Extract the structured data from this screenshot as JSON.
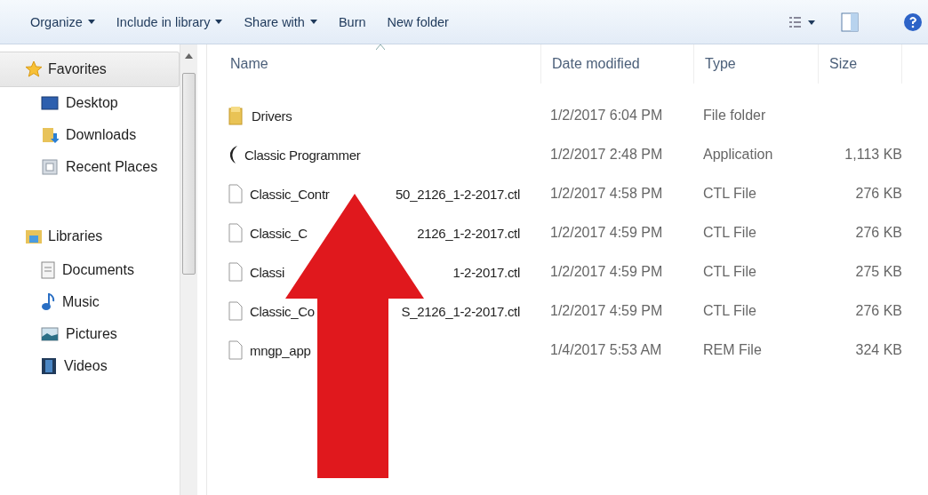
{
  "toolbar": {
    "items": [
      {
        "label": "Organize",
        "dropdown": true
      },
      {
        "label": "Include in library",
        "dropdown": true
      },
      {
        "label": "Share with",
        "dropdown": true
      },
      {
        "label": "Burn",
        "dropdown": false
      },
      {
        "label": "New folder",
        "dropdown": false
      }
    ]
  },
  "sidebar": {
    "groups": [
      {
        "label": "Favorites",
        "selected": true,
        "children": [
          {
            "label": "Desktop"
          },
          {
            "label": "Downloads"
          },
          {
            "label": "Recent Places"
          }
        ]
      },
      {
        "label": "Libraries",
        "selected": false,
        "children": [
          {
            "label": "Documents"
          },
          {
            "label": "Music"
          },
          {
            "label": "Pictures"
          },
          {
            "label": "Videos"
          }
        ]
      }
    ]
  },
  "table": {
    "columns": [
      {
        "label": "Name",
        "sorted": true
      },
      {
        "label": "Date modified",
        "sorted": false
      },
      {
        "label": "Type",
        "sorted": false
      },
      {
        "label": "Size",
        "sorted": false
      }
    ],
    "rows": [
      {
        "kind": "folder",
        "name": "Drivers",
        "name_end": "",
        "date": "1/2/2017 6:04 PM",
        "type": "File folder",
        "size": ""
      },
      {
        "kind": "application",
        "name": "Classic Programmer",
        "name_end": "",
        "date": "1/2/2017 2:48 PM",
        "type": "Application",
        "size": "1,113 KB"
      },
      {
        "kind": "file",
        "name": "Classic_Contr",
        "name_end": "50_2126_1-2-2017.ctl",
        "date": "1/2/2017 4:58 PM",
        "type": "CTL File",
        "size": "276 KB"
      },
      {
        "kind": "file",
        "name": "Classic_C",
        "name_end": "2126_1-2-2017.ctl",
        "date": "1/2/2017 4:59 PM",
        "type": "CTL File",
        "size": "276 KB"
      },
      {
        "kind": "file",
        "name": "Classi",
        "name_end": "1-2-2017.ctl",
        "date": "1/2/2017 4:59 PM",
        "type": "CTL File",
        "size": "275 KB"
      },
      {
        "kind": "file",
        "name": "Classic_Co",
        "name_end": "S_2126_1-2-2017.ctl",
        "date": "1/2/2017 4:59 PM",
        "type": "CTL File",
        "size": "276 KB"
      },
      {
        "kind": "file",
        "name": "mngp_app",
        "name_end": "",
        "date": "1/4/2017 5:53 AM",
        "type": "REM File",
        "size": "324 KB"
      }
    ]
  }
}
